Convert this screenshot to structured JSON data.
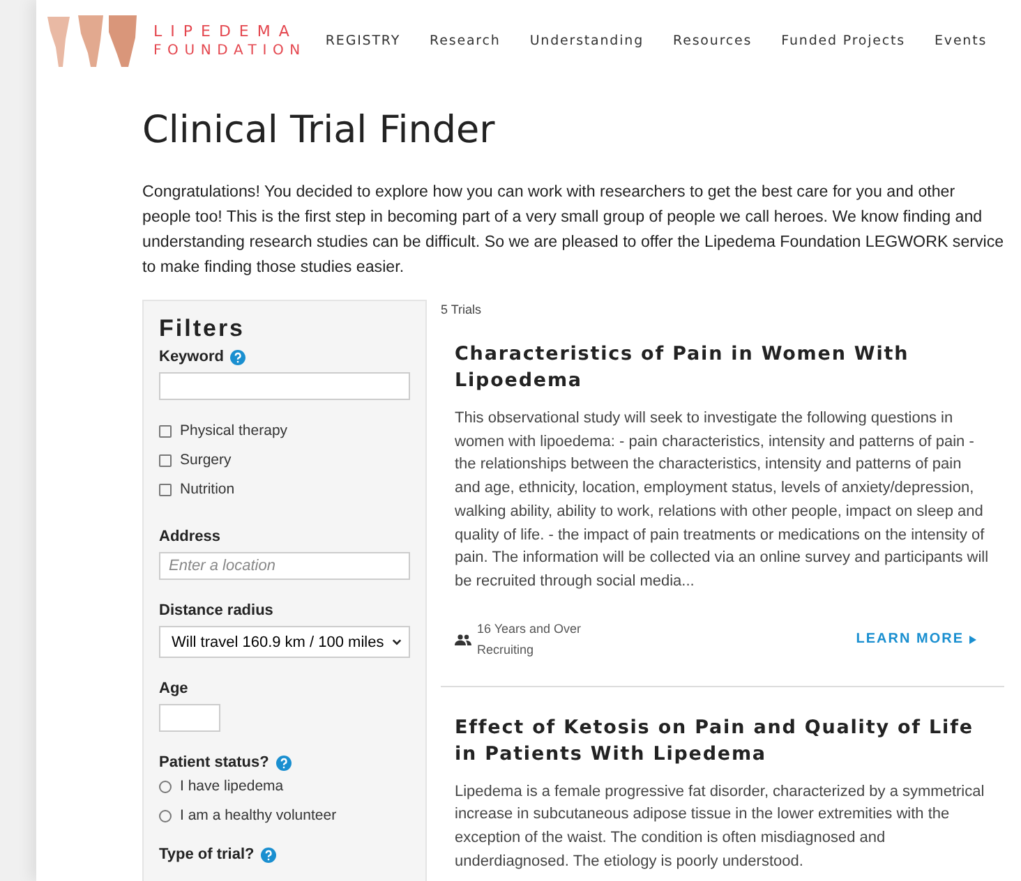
{
  "header": {
    "logo_top": "LIPEDEMA",
    "logo_bottom": "FOUNDATION",
    "nav": [
      {
        "label": "REGISTRY"
      },
      {
        "label": "Research"
      },
      {
        "label": "Understanding"
      },
      {
        "label": "Resources"
      },
      {
        "label": "Funded Projects"
      },
      {
        "label": "Events"
      }
    ]
  },
  "title": "Clinical Trial Finder",
  "intro": "Congratulations! You decided to explore how you can work with researchers to get the best care for you and other people too! This is the first step in becoming part of a very small group of people we call heroes. We know finding and understanding research studies can be difficult. So we are pleased to offer the Lipedema Foundation LEGWORK service to make finding those studies easier.",
  "filters": {
    "heading": "Filters",
    "keyword": {
      "label": "Keyword"
    },
    "checkboxes": [
      {
        "label": "Physical therapy",
        "checked": false
      },
      {
        "label": "Surgery",
        "checked": false
      },
      {
        "label": "Nutrition",
        "checked": false
      }
    ],
    "address": {
      "label": "Address",
      "placeholder": "Enter a location"
    },
    "distance": {
      "label": "Distance radius",
      "value": "Will travel 160.9 km / 100 miles"
    },
    "age": {
      "label": "Age"
    },
    "patient_status": {
      "label": "Patient status?",
      "options": [
        {
          "label": "I have lipedema",
          "selected": false
        },
        {
          "label": "I am a healthy volunteer",
          "selected": false
        }
      ]
    },
    "trial_type": {
      "label": "Type of trial?"
    }
  },
  "results": {
    "count": "5 Trials",
    "trials": [
      {
        "title": "Characteristics of Pain in Women With Lipoedema",
        "summary": "This observational study will seek to investigate the following questions in women with lipoedema: - pain characteristics, intensity and patterns of pain - the relationships between the characteristics, intensity and patterns of pain and age, ethnicity, location, employment status, levels of anxiety/depression, walking ability, ability to work, relations with other people, impact on sleep and quality of life. - the impact of pain treatments or medications on the intensity of pain. The information will be collected via an online survey and participants will be recruited through social media...",
        "ages": "16 Years and Over",
        "status": "Recruiting",
        "link": "LEARN MORE"
      },
      {
        "title": "Effect of Ketosis on Pain and Quality of Life in Patients With Lipedema",
        "summary": "Lipedema is a female progressive fat disorder, characterized by a symmetrical increase in subcutaneous adipose tissue in the lower extremities with the exception of the waist. The condition is often misdiagnosed and underdiagnosed. The etiology is poorly understood."
      }
    ]
  }
}
